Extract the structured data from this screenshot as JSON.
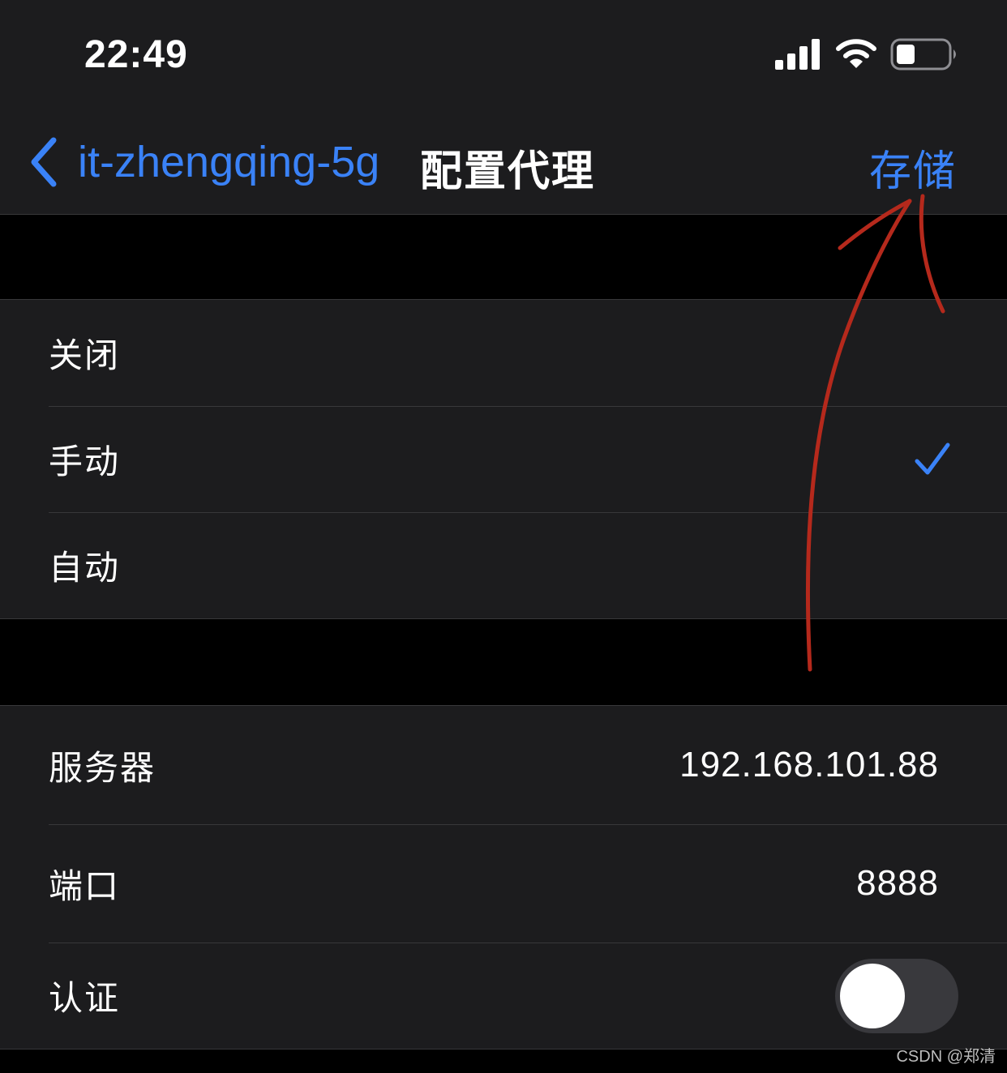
{
  "status_bar": {
    "time": "22:49",
    "icons": [
      "signal-bars-icon",
      "wifi-icon",
      "battery-icon"
    ]
  },
  "nav": {
    "back_label": "it-zhengqing-5g",
    "title": "配置代理",
    "save_label": "存储"
  },
  "proxy_modes": {
    "items": [
      {
        "label": "关闭",
        "selected": false
      },
      {
        "label": "手动",
        "selected": true
      },
      {
        "label": "自动",
        "selected": false
      }
    ]
  },
  "manual_settings": {
    "server_label": "服务器",
    "server_value": "192.168.101.88",
    "port_label": "端口",
    "port_value": "8888",
    "auth_label": "认证",
    "auth_enabled": false
  },
  "colors": {
    "accent": "#3a82f7",
    "background": "#000000",
    "cell": "#1c1c1e",
    "annotation": "#b5291c"
  },
  "watermark": "CSDN @郑清"
}
